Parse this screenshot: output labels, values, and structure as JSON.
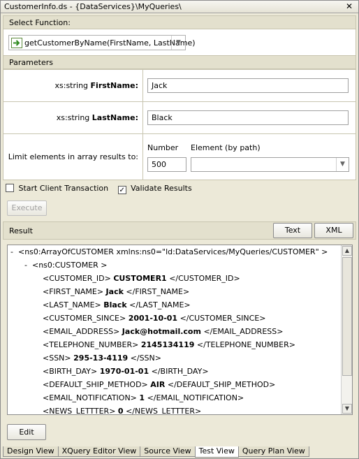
{
  "window": {
    "title": "CustomerInfo.ds - {DataServices}\\MyQueries\\",
    "close_glyph": "✕"
  },
  "select_function": {
    "header": "Select Function:",
    "selected": "getCustomerByName(FirstName, LastName)",
    "icon": "function-arrow-icon"
  },
  "parameters": {
    "header": "Parameters",
    "rows": [
      {
        "type": "xs:string",
        "name": "FirstName:",
        "value": "Jack"
      },
      {
        "type": "xs:string",
        "name": "LastName:",
        "value": "Black"
      }
    ],
    "limit_label": "Limit elements in array results to:",
    "number_label": "Number",
    "element_label": "Element (by path)",
    "number_value": "500",
    "element_value": ""
  },
  "options": {
    "start_client_transaction": {
      "label": "Start Client Transaction",
      "checked": false
    },
    "validate_results": {
      "label": "Validate Results",
      "checked": true
    }
  },
  "execute_label": "Execute",
  "result": {
    "header": "Result",
    "text_button": "Text",
    "xml_button": "XML",
    "lines": [
      {
        "toggle": "-",
        "pre": "<ns0:ArrayOfCUSTOMER xmlns:ns0=\"ld:DataServices/MyQueries/CUSTOMER\" >",
        "value": "",
        "post": ""
      },
      {
        "toggle": "-",
        "pre": "<ns0:CUSTOMER >",
        "value": "",
        "post": ""
      },
      {
        "toggle": "",
        "pre": "<CUSTOMER_ID>",
        "value": "CUSTOMER1",
        "post": "</CUSTOMER_ID>"
      },
      {
        "toggle": "",
        "pre": "<FIRST_NAME>",
        "value": "Jack",
        "post": "</FIRST_NAME>"
      },
      {
        "toggle": "",
        "pre": "<LAST_NAME>",
        "value": "Black",
        "post": "</LAST_NAME>"
      },
      {
        "toggle": "",
        "pre": "<CUSTOMER_SINCE>",
        "value": "2001-10-01",
        "post": "</CUSTOMER_SINCE>"
      },
      {
        "toggle": "",
        "pre": "<EMAIL_ADDRESS>",
        "value": "Jack@hotmail.com",
        "post": "</EMAIL_ADDRESS>"
      },
      {
        "toggle": "",
        "pre": "<TELEPHONE_NUMBER>",
        "value": "2145134119",
        "post": "</TELEPHONE_NUMBER>"
      },
      {
        "toggle": "",
        "pre": "<SSN>",
        "value": "295-13-4119",
        "post": "</SSN>"
      },
      {
        "toggle": "",
        "pre": "<BIRTH_DAY>",
        "value": "1970-01-01",
        "post": "</BIRTH_DAY>"
      },
      {
        "toggle": "",
        "pre": "<DEFAULT_SHIP_METHOD>",
        "value": "AIR",
        "post": "</DEFAULT_SHIP_METHOD>"
      },
      {
        "toggle": "",
        "pre": "<EMAIL_NOTIFICATION>",
        "value": "1",
        "post": "</EMAIL_NOTIFICATION>"
      },
      {
        "toggle": "",
        "pre": "<NEWS_LETTTER>",
        "value": "0",
        "post": "</NEWS_LETTTER>"
      }
    ]
  },
  "edit_label": "Edit",
  "tabs": [
    "Design View",
    "XQuery Editor View",
    "Source View",
    "Test View",
    "Query Plan View"
  ],
  "active_tab": "Test View"
}
